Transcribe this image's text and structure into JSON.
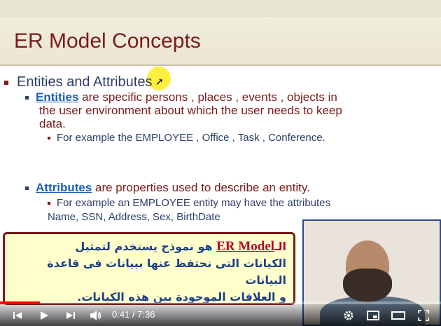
{
  "slide": {
    "title": "ER Model Concepts",
    "bullet1": "Entities and Attributes",
    "entities": {
      "term": "Entities",
      "line1": " are specific persons , places , events , objects in",
      "line2": "the user environment about which the user needs to keep",
      "line3": "data.",
      "example": "For example the EMPLOYEE , Office , Task , Conference."
    },
    "attributes": {
      "term": "Attributes",
      "line1": " are properties used to describe an entity.",
      "example_line1": "For example an EMPLOYEE entity may have the attributes",
      "example_line2": "Name, SSN, Address, Sex, BirthDate"
    }
  },
  "caption": {
    "lead": "الـ",
    "term": "ER Model",
    "line1": " هو نموذج يستخدم لتمثيل",
    "line2": "الكيانات التى نحتفظ عنها ببيانات فى قاعدة البيانات",
    "line3": "و العلاقات الموجودة بين هذه الكيانات."
  },
  "player": {
    "time_current": "0:41",
    "time_total": "7:36",
    "time_display": "0:41 / 7:36",
    "progress_fraction": 0.09,
    "accent_color": "#ff0000",
    "icons": [
      "skip-back-icon",
      "play-icon",
      "skip-next-icon",
      "volume-icon",
      "settings-icon",
      "miniplayer-icon",
      "theater-icon",
      "fullscreen-icon"
    ]
  }
}
